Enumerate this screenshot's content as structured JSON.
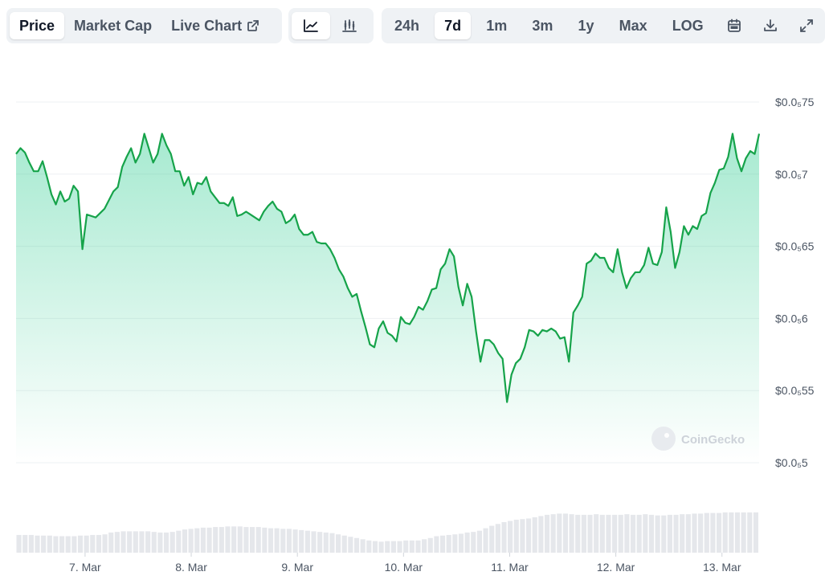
{
  "toolbar": {
    "metric_tabs": [
      {
        "label": "Price",
        "active": true
      },
      {
        "label": "Market Cap",
        "active": false
      },
      {
        "label": "Live Chart",
        "active": false
      }
    ],
    "chart_type_icons": [
      "line-chart-icon",
      "candlestick-icon"
    ],
    "ranges": [
      {
        "label": "24h",
        "active": false
      },
      {
        "label": "7d",
        "active": true
      },
      {
        "label": "1m",
        "active": false
      },
      {
        "label": "3m",
        "active": false
      },
      {
        "label": "1y",
        "active": false
      },
      {
        "label": "Max",
        "active": false
      },
      {
        "label": "LOG",
        "active": false
      }
    ],
    "tool_icons": [
      "calendar-icon",
      "download-icon",
      "fullscreen-icon"
    ]
  },
  "watermark": "CoinGecko",
  "colors": {
    "line": "#16a34a",
    "fill": "#16c784",
    "volume": "#e5e7eb",
    "grid": "#eef0f3",
    "accent_bg": "#eff2f5"
  },
  "chart_data": {
    "type": "line",
    "title": "",
    "xlabel": "",
    "ylabel": "",
    "y_ticks": [
      {
        "value": 7.5e-06,
        "label": "$0.0₅75"
      },
      {
        "value": 7e-06,
        "label": "$0.0₅7"
      },
      {
        "value": 6.5e-06,
        "label": "$0.0₅65"
      },
      {
        "value": 6e-06,
        "label": "$0.0₅6"
      },
      {
        "value": 5.5e-06,
        "label": "$0.0₅55"
      },
      {
        "value": 5e-06,
        "label": "$0.0₅5"
      }
    ],
    "ylim": [
      5e-06,
      7.5e-06
    ],
    "x_ticks": [
      "7. Mar",
      "8. Mar",
      "9. Mar",
      "10. Mar",
      "11. Mar",
      "12. Mar",
      "13. Mar"
    ],
    "x_tick_days": [
      0.65,
      1.65,
      2.65,
      3.65,
      4.65,
      5.65,
      6.65
    ],
    "xlim_days": [
      0,
      7
    ],
    "grid": true,
    "series": [
      {
        "values": [
          7.14,
          7.18,
          7.15,
          7.08,
          7.02,
          7.02,
          7.09,
          6.98,
          6.86,
          6.79,
          6.88,
          6.81,
          6.83,
          6.92,
          6.88,
          6.48,
          6.72,
          6.71,
          6.7,
          6.73,
          6.76,
          6.82,
          6.88,
          6.91,
          7.05,
          7.12,
          7.18,
          7.08,
          7.14,
          7.28,
          7.18,
          7.08,
          7.14,
          7.28,
          7.2,
          7.14,
          7.02,
          7.02,
          6.92,
          6.98,
          6.86,
          6.94,
          6.93,
          6.98,
          6.88,
          6.84,
          6.8,
          6.8,
          6.78,
          6.84,
          6.71,
          6.72,
          6.74,
          6.72,
          6.7,
          6.68,
          6.74,
          6.78,
          6.81,
          6.76,
          6.74,
          6.66,
          6.68,
          6.72,
          6.62,
          6.58,
          6.58,
          6.6,
          6.53,
          6.52,
          6.52,
          6.48,
          6.42,
          6.34,
          6.29,
          6.21,
          6.15,
          6.17,
          6.05,
          5.94,
          5.82,
          5.8,
          5.93,
          5.98,
          5.9,
          5.88,
          5.84,
          6.01,
          5.97,
          5.96,
          6.01,
          6.08,
          6.06,
          6.12,
          6.2,
          6.21,
          6.34,
          6.38,
          6.48,
          6.43,
          6.22,
          6.09,
          6.24,
          6.15,
          5.91,
          5.7,
          5.85,
          5.85,
          5.82,
          5.76,
          5.72,
          5.42,
          5.61,
          5.69,
          5.72,
          5.8,
          5.92,
          5.91,
          5.88,
          5.92,
          5.91,
          5.93,
          5.91,
          5.86,
          5.87,
          5.7,
          6.04,
          6.09,
          6.15,
          6.38,
          6.4,
          6.45,
          6.42,
          6.42,
          6.35,
          6.32,
          6.48,
          6.32,
          6.21,
          6.28,
          6.32,
          6.32,
          6.37,
          6.49,
          6.38,
          6.37,
          6.46,
          6.77,
          6.6,
          6.35,
          6.46,
          6.64,
          6.58,
          6.64,
          6.62,
          6.71,
          6.73,
          6.87,
          6.94,
          7.03,
          7.04,
          7.12,
          7.28,
          7.11,
          7.02,
          7.11,
          7.16,
          7.14,
          7.28
        ]
      }
    ],
    "volume": [
      0.29,
      0.29,
      0.29,
      0.28,
      0.28,
      0.28,
      0.27,
      0.27,
      0.27,
      0.27,
      0.28,
      0.28,
      0.29,
      0.29,
      0.3,
      0.33,
      0.34,
      0.35,
      0.35,
      0.35,
      0.35,
      0.35,
      0.34,
      0.33,
      0.33,
      0.34,
      0.36,
      0.38,
      0.39,
      0.4,
      0.41,
      0.41,
      0.42,
      0.42,
      0.43,
      0.43,
      0.43,
      0.42,
      0.42,
      0.42,
      0.41,
      0.4,
      0.4,
      0.39,
      0.39,
      0.38,
      0.37,
      0.36,
      0.35,
      0.34,
      0.33,
      0.32,
      0.3,
      0.28,
      0.26,
      0.24,
      0.22,
      0.2,
      0.19,
      0.18,
      0.19,
      0.19,
      0.19,
      0.2,
      0.2,
      0.2,
      0.22,
      0.24,
      0.27,
      0.28,
      0.29,
      0.3,
      0.31,
      0.33,
      0.34,
      0.36,
      0.4,
      0.44,
      0.47,
      0.5,
      0.52,
      0.54,
      0.55,
      0.56,
      0.58,
      0.6,
      0.62,
      0.63,
      0.64,
      0.64,
      0.63,
      0.62,
      0.62,
      0.62,
      0.63,
      0.62,
      0.62,
      0.62,
      0.62,
      0.63,
      0.62,
      0.62,
      0.63,
      0.62,
      0.61,
      0.61,
      0.62,
      0.62,
      0.63,
      0.63,
      0.64,
      0.64,
      0.65,
      0.65,
      0.65,
      0.66,
      0.66,
      0.66,
      0.66,
      0.66,
      0.66
    ]
  }
}
